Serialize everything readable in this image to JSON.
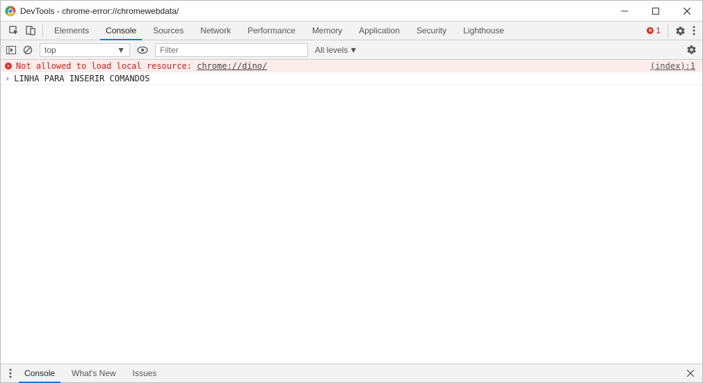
{
  "window": {
    "title": "DevTools - chrome-error://chromewebdata/"
  },
  "tabs": {
    "elements": "Elements",
    "console": "Console",
    "sources": "Sources",
    "network": "Network",
    "performance": "Performance",
    "memory": "Memory",
    "application": "Application",
    "security": "Security",
    "lighthouse": "Lighthouse"
  },
  "errorBadge": {
    "count": "1"
  },
  "toolbar": {
    "context": "top",
    "filter_placeholder": "Filter",
    "levels": "All levels"
  },
  "console": {
    "error": {
      "message": "Not allowed to load local resource: ",
      "link": "chrome://dino/",
      "source": "(index):1"
    },
    "prompt": "LINHA PARA INSERIR COMANDOS"
  },
  "drawer": {
    "console": "Console",
    "whatsnew": "What's New",
    "issues": "Issues"
  }
}
